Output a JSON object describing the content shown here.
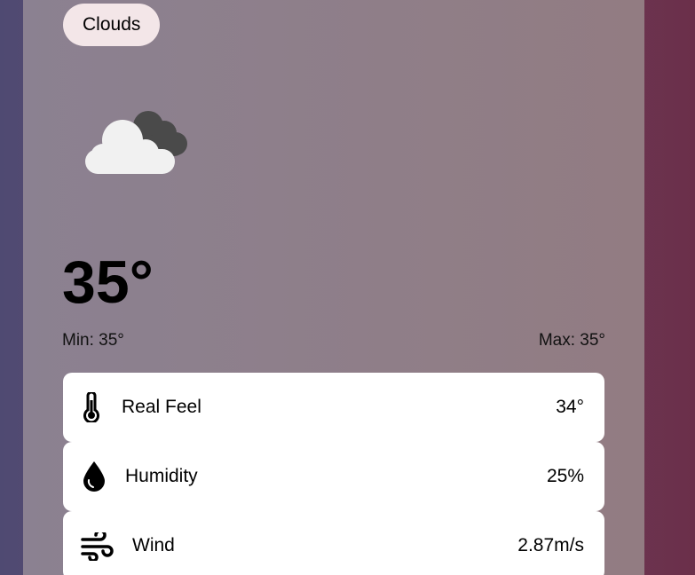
{
  "condition": "Clouds",
  "temperature": "35°",
  "min": "Min: 35°",
  "max": "Max: 35°",
  "details": [
    {
      "icon": "thermometer-icon",
      "label": "Real Feel",
      "value": "34°"
    },
    {
      "icon": "droplet-icon",
      "label": "Humidity",
      "value": "25%"
    },
    {
      "icon": "wind-icon",
      "label": "Wind",
      "value": "2.87m/s"
    }
  ],
  "colors": {
    "chip_bg": "#f3e6e8",
    "card_bg": "#8e7f8a",
    "cloud_light": "#f1f1f1",
    "cloud_dark": "#4a4a4a"
  }
}
